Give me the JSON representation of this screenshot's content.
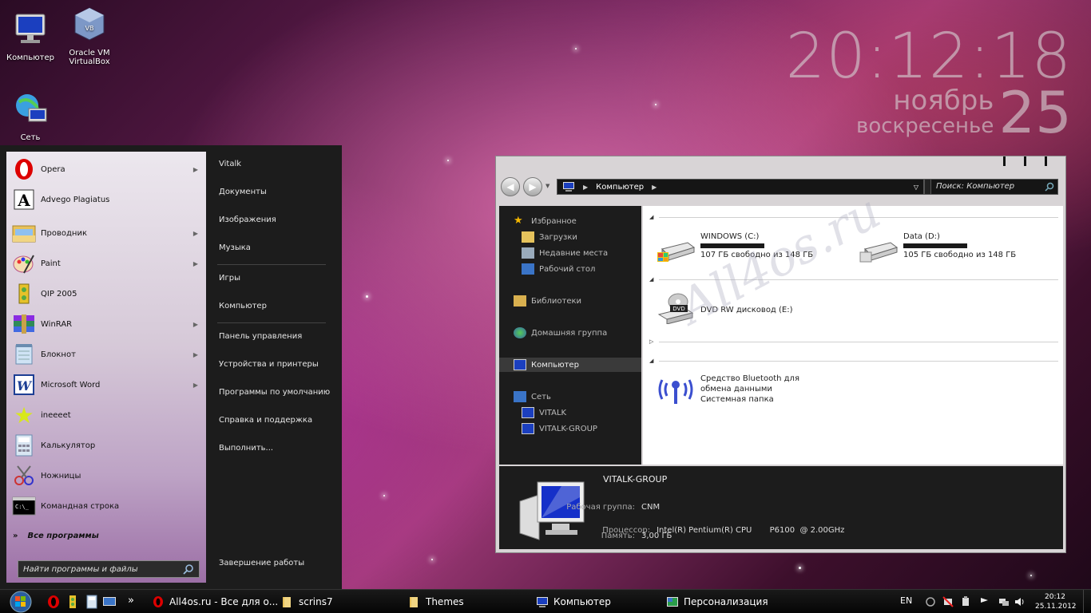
{
  "desktop": {
    "icons": [
      {
        "label": "Компьютер",
        "icon": "computer-icon"
      },
      {
        "label": "Oracle VM VirtualBox",
        "icon": "virtualbox-icon"
      },
      {
        "label": "Сеть",
        "icon": "network-icon"
      }
    ]
  },
  "clock": {
    "time": "20:12:18",
    "month": "ноябрь",
    "weekday": "воскресенье",
    "day": "25"
  },
  "start_menu": {
    "programs": [
      {
        "label": "Opera",
        "icon": "opera-icon",
        "submenu": true
      },
      {
        "label": "Advego Plagiatus",
        "icon": "advego-icon",
        "submenu": false
      },
      {
        "label": "Проводник",
        "icon": "explorer-icon",
        "submenu": true
      },
      {
        "label": "Paint",
        "icon": "paint-icon",
        "submenu": true
      },
      {
        "label": "QIP 2005",
        "icon": "qip-icon",
        "submenu": false
      },
      {
        "label": "WinRAR",
        "icon": "winrar-icon",
        "submenu": true
      },
      {
        "label": "Блокнот",
        "icon": "notepad-icon",
        "submenu": true
      },
      {
        "label": "Microsoft Word",
        "icon": "word-icon",
        "submenu": true
      },
      {
        "label": "ineeeet",
        "icon": "star-icon",
        "submenu": false
      },
      {
        "label": "Калькулятор",
        "icon": "calculator-icon",
        "submenu": false
      },
      {
        "label": "Ножницы",
        "icon": "scissors-icon",
        "submenu": false
      },
      {
        "label": "Командная строка",
        "icon": "cmd-icon",
        "submenu": false
      }
    ],
    "all_programs": "Все программы",
    "search_placeholder": "Найти программы и файлы",
    "right_items": [
      "Vitalk",
      "Документы",
      "Изображения",
      "Музыка",
      "Игры",
      "Компьютер",
      "Панель управления",
      "Устройства и принтеры",
      "Программы по умолчанию",
      "Справка и поддержка",
      "Выполнить..."
    ],
    "shutdown": "Завершение работы"
  },
  "explorer": {
    "address": "Компьютер",
    "search_placeholder": "Поиск: Компьютер",
    "nav": {
      "favorites": "Избранное",
      "downloads": "Загрузки",
      "recent": "Недавние места",
      "desktop": "Рабочий стол",
      "libraries": "Библиотеки",
      "homegroup": "Домашняя группа",
      "computer": "Компьютер",
      "network": "Сеть",
      "net_vitalk": "VITALK",
      "net_vitalk_group": "VITALK-GROUP"
    },
    "drives": [
      {
        "name": "WINDOWS (C:)",
        "free": "107 ГБ свободно из 148 ГБ"
      },
      {
        "name": "Data (D:)",
        "free": "105 ГБ свободно из 148 ГБ"
      }
    ],
    "dvd": {
      "name": "DVD RW дисковод (E:)",
      "badge": "DVD"
    },
    "bluetooth": {
      "name": "Средство Bluetooth для обмена данными",
      "type": "Системная папка"
    },
    "details": {
      "name": "VITALK-GROUP",
      "workgroup_label": "Рабочая группа:",
      "workgroup": "CNM",
      "cpu_label": "Процессор:",
      "cpu": "Intel(R) Pentium(R) CPU       P6100  @ 2.00GHz",
      "memory_label": "Память:",
      "memory": "3,00 ГБ"
    }
  },
  "taskbar": {
    "items": [
      {
        "label": "All4os.ru - Все для о...",
        "icon": "opera-icon"
      },
      {
        "label": "scrins7",
        "icon": "folder-icon"
      },
      {
        "label": "Themes",
        "icon": "folder-icon"
      },
      {
        "label": "Компьютер",
        "icon": "computer-icon"
      },
      {
        "label": "Персонализация",
        "icon": "personalization-icon"
      }
    ],
    "more": "»",
    "lang": "EN",
    "time": "20:12",
    "date": "25.11.2012"
  },
  "watermark": "All4os.ru"
}
